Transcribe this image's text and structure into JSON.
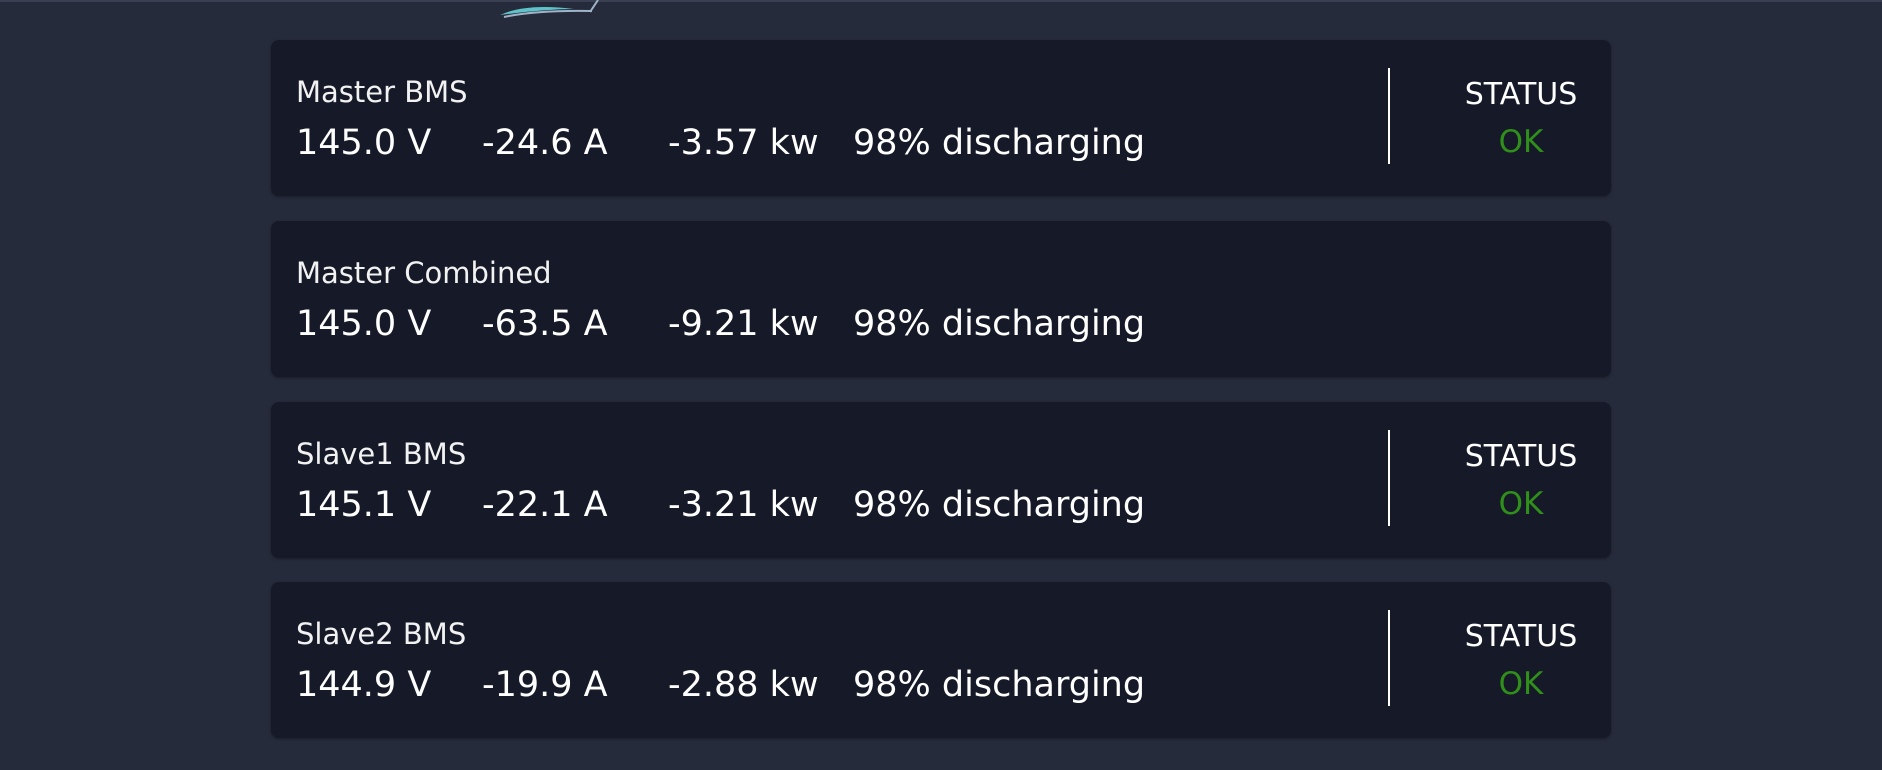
{
  "colors": {
    "page_background": "#262b3b",
    "card_background": "#161a28",
    "text": "#ffffff",
    "status_ok": "#2f8f1a",
    "logo_accent": "#5ec3c8"
  },
  "logo": {
    "icon": "boat-logo-icon"
  },
  "cards": [
    {
      "name": "Master BMS",
      "voltage": "145.0 V",
      "current": "-24.6 A",
      "power": "-3.57 kw",
      "soc": "98% discharging",
      "status_label": "STATUS",
      "status_value": "OK"
    },
    {
      "name": "Master Combined",
      "voltage": "145.0 V",
      "current": "-63.5 A",
      "power": "-9.21 kw",
      "soc": "98% discharging"
    },
    {
      "name": "Slave1 BMS",
      "voltage": "145.1 V",
      "current": "-22.1 A",
      "power": "-3.21 kw",
      "soc": "98% discharging",
      "status_label": "STATUS",
      "status_value": "OK"
    },
    {
      "name": "Slave2 BMS",
      "voltage": "144.9 V",
      "current": "-19.9 A",
      "power": "-2.88 kw",
      "soc": "98% discharging",
      "status_label": "STATUS",
      "status_value": "OK"
    }
  ]
}
